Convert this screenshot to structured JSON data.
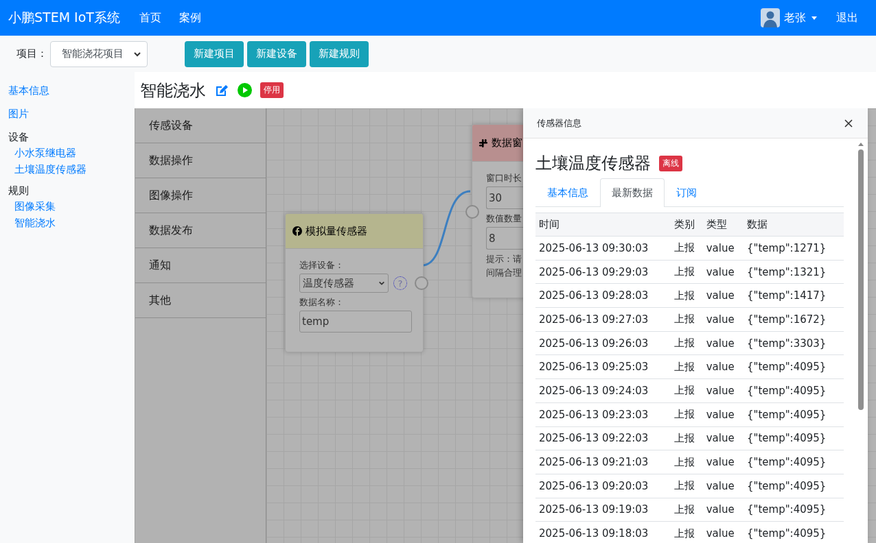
{
  "navbar": {
    "brand": "小鹏STEM IoT系统",
    "links": [
      "首页",
      "案例"
    ],
    "user": "老张",
    "logout": "退出"
  },
  "toolbar": {
    "project_label": "项目：",
    "project_value": "智能浇花项目",
    "buttons": [
      "新建项目",
      "新建设备",
      "新建规则"
    ]
  },
  "sidebar": {
    "items": [
      {
        "label": "基本信息",
        "kind": "link"
      },
      {
        "label": "图片",
        "kind": "link"
      },
      {
        "label": "设备",
        "kind": "group",
        "children": [
          {
            "label": "小水泵继电器"
          },
          {
            "label": "土壤温度传感器"
          }
        ]
      },
      {
        "label": "规则",
        "kind": "group",
        "children": [
          {
            "label": "图像采集"
          },
          {
            "label": "智能浇水"
          }
        ]
      }
    ]
  },
  "rule": {
    "title": "智能浇水",
    "status": "停用"
  },
  "palette": [
    "传感设备",
    "数据操作",
    "图像操作",
    "数据发布",
    "通知",
    "其他"
  ],
  "sensor_node": {
    "title": "模拟量传感器",
    "device_label": "选择设备：",
    "device_value": "温度传感器",
    "help": "?",
    "name_label": "数据名称：",
    "name_value": "temp"
  },
  "window_node": {
    "title": "数据窗",
    "duration_label": "窗口时长",
    "duration_value": "30",
    "count_label": "数值数量",
    "count_value": "8",
    "hint_lines": [
      "提示：请",
      "间隔合理"
    ]
  },
  "panel": {
    "title": "传感器信息",
    "sensor_name": "土壤温度传感器",
    "status": "离线",
    "tabs": [
      {
        "label": "基本信息",
        "selected": false
      },
      {
        "label": "最新数据",
        "selected": true
      },
      {
        "label": "订阅",
        "selected": false
      }
    ],
    "table": {
      "columns": [
        "时间",
        "类别",
        "类型",
        "数据"
      ],
      "rows": [
        [
          "2025-06-13 09:30:03",
          "上报",
          "value",
          "{\"temp\":1271}"
        ],
        [
          "2025-06-13 09:29:03",
          "上报",
          "value",
          "{\"temp\":1321}"
        ],
        [
          "2025-06-13 09:28:03",
          "上报",
          "value",
          "{\"temp\":1417}"
        ],
        [
          "2025-06-13 09:27:03",
          "上报",
          "value",
          "{\"temp\":1672}"
        ],
        [
          "2025-06-13 09:26:03",
          "上报",
          "value",
          "{\"temp\":3303}"
        ],
        [
          "2025-06-13 09:25:03",
          "上报",
          "value",
          "{\"temp\":4095}"
        ],
        [
          "2025-06-13 09:24:03",
          "上报",
          "value",
          "{\"temp\":4095}"
        ],
        [
          "2025-06-13 09:23:03",
          "上报",
          "value",
          "{\"temp\":4095}"
        ],
        [
          "2025-06-13 09:22:03",
          "上报",
          "value",
          "{\"temp\":4095}"
        ],
        [
          "2025-06-13 09:21:03",
          "上报",
          "value",
          "{\"temp\":4095}"
        ],
        [
          "2025-06-13 09:20:03",
          "上报",
          "value",
          "{\"temp\":4095}"
        ],
        [
          "2025-06-13 09:19:03",
          "上报",
          "value",
          "{\"temp\":4095}"
        ],
        [
          "2025-06-13 09:18:03",
          "上报",
          "value",
          "{\"temp\":4095}"
        ]
      ]
    }
  }
}
